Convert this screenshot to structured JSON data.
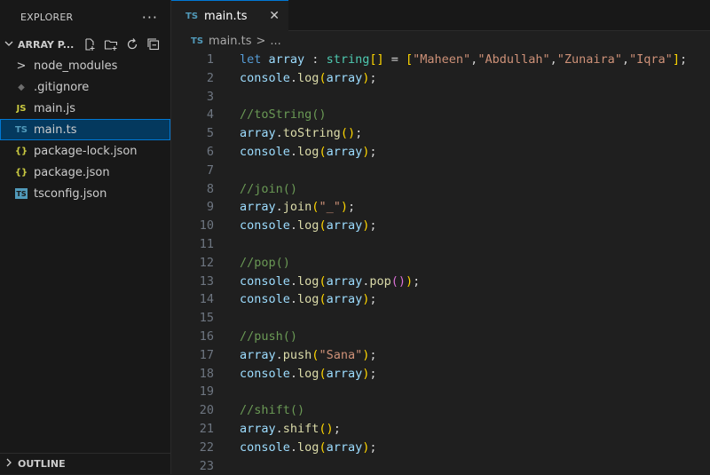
{
  "explorer": {
    "title": "EXPLORER",
    "more": "···",
    "project": "ARRAY P...",
    "items": [
      {
        "label": "node_modules",
        "icon": ">",
        "icon_name": "chevron-right-icon",
        "color": "#cccccc"
      },
      {
        "label": ".gitignore",
        "icon": "◆",
        "icon_name": "git-icon",
        "color": "#6d6d6d"
      },
      {
        "label": "main.js",
        "icon": "JS",
        "icon_name": "js-file-icon",
        "color": "#cbcb41"
      },
      {
        "label": "main.ts",
        "icon": "TS",
        "icon_name": "ts-file-icon",
        "color": "#519aba"
      },
      {
        "label": "package-lock.json",
        "icon": "{}",
        "icon_name": "json-file-icon",
        "color": "#cbcb41"
      },
      {
        "label": "package.json",
        "icon": "{}",
        "icon_name": "json-file-icon",
        "color": "#cbcb41"
      },
      {
        "label": "tsconfig.json",
        "icon": "TS",
        "icon_name": "tsconfig-file-icon",
        "color": "#519aba"
      }
    ],
    "active_index": 3,
    "outline": "OUTLINE"
  },
  "tab": {
    "badge": "TS",
    "label": "main.ts",
    "close": "✕"
  },
  "breadcrumb": {
    "badge": "TS",
    "file": "main.ts",
    "sep": ">",
    "more": "..."
  },
  "code_lines": [
    [
      [
        "kw",
        "let"
      ],
      [
        "pun",
        " "
      ],
      [
        "var",
        "array"
      ],
      [
        "pun",
        " : "
      ],
      [
        "ty",
        "string"
      ],
      [
        "b1",
        "[]"
      ],
      [
        "pun",
        " = "
      ],
      [
        "b1",
        "["
      ],
      [
        "str",
        "\"Maheen\""
      ],
      [
        "pun",
        ","
      ],
      [
        "str",
        "\"Abdullah\""
      ],
      [
        "pun",
        ","
      ],
      [
        "str",
        "\"Zunaira\""
      ],
      [
        "pun",
        ","
      ],
      [
        "str",
        "\"Iqra\""
      ],
      [
        "b1",
        "]"
      ],
      [
        "pun",
        ";"
      ]
    ],
    [
      [
        "var",
        "console"
      ],
      [
        "pun",
        "."
      ],
      [
        "fn",
        "log"
      ],
      [
        "b1",
        "("
      ],
      [
        "var",
        "array"
      ],
      [
        "b1",
        ")"
      ],
      [
        "pun",
        ";"
      ]
    ],
    [],
    [
      [
        "cm",
        "//toString()"
      ]
    ],
    [
      [
        "var",
        "array"
      ],
      [
        "pun",
        "."
      ],
      [
        "fn",
        "toString"
      ],
      [
        "b1",
        "()"
      ],
      [
        "pun",
        ";"
      ]
    ],
    [
      [
        "var",
        "console"
      ],
      [
        "pun",
        "."
      ],
      [
        "fn",
        "log"
      ],
      [
        "b1",
        "("
      ],
      [
        "var",
        "array"
      ],
      [
        "b1",
        ")"
      ],
      [
        "pun",
        ";"
      ]
    ],
    [],
    [
      [
        "cm",
        "//join()"
      ]
    ],
    [
      [
        "var",
        "array"
      ],
      [
        "pun",
        "."
      ],
      [
        "fn",
        "join"
      ],
      [
        "b1",
        "("
      ],
      [
        "str",
        "\"_\""
      ],
      [
        "b1",
        ")"
      ],
      [
        "pun",
        ";"
      ]
    ],
    [
      [
        "var",
        "console"
      ],
      [
        "pun",
        "."
      ],
      [
        "fn",
        "log"
      ],
      [
        "b1",
        "("
      ],
      [
        "var",
        "array"
      ],
      [
        "b1",
        ")"
      ],
      [
        "pun",
        ";"
      ]
    ],
    [],
    [
      [
        "cm",
        "//pop()"
      ]
    ],
    [
      [
        "var",
        "console"
      ],
      [
        "pun",
        "."
      ],
      [
        "fn",
        "log"
      ],
      [
        "b1",
        "("
      ],
      [
        "var",
        "array"
      ],
      [
        "pun",
        "."
      ],
      [
        "fn",
        "pop"
      ],
      [
        "b2",
        "()"
      ],
      [
        "b1",
        ")"
      ],
      [
        "pun",
        ";"
      ]
    ],
    [
      [
        "var",
        "console"
      ],
      [
        "pun",
        "."
      ],
      [
        "fn",
        "log"
      ],
      [
        "b1",
        "("
      ],
      [
        "var",
        "array"
      ],
      [
        "b1",
        ")"
      ],
      [
        "pun",
        ";"
      ]
    ],
    [],
    [
      [
        "cm",
        "//push()"
      ]
    ],
    [
      [
        "var",
        "array"
      ],
      [
        "pun",
        "."
      ],
      [
        "fn",
        "push"
      ],
      [
        "b1",
        "("
      ],
      [
        "str",
        "\"Sana\""
      ],
      [
        "b1",
        ")"
      ],
      [
        "pun",
        ";"
      ]
    ],
    [
      [
        "var",
        "console"
      ],
      [
        "pun",
        "."
      ],
      [
        "fn",
        "log"
      ],
      [
        "b1",
        "("
      ],
      [
        "var",
        "array"
      ],
      [
        "b1",
        ")"
      ],
      [
        "pun",
        ";"
      ]
    ],
    [],
    [
      [
        "cm",
        "//shift()"
      ]
    ],
    [
      [
        "var",
        "array"
      ],
      [
        "pun",
        "."
      ],
      [
        "fn",
        "shift"
      ],
      [
        "b1",
        "()"
      ],
      [
        "pun",
        ";"
      ]
    ],
    [
      [
        "var",
        "console"
      ],
      [
        "pun",
        "."
      ],
      [
        "fn",
        "log"
      ],
      [
        "b1",
        "("
      ],
      [
        "var",
        "array"
      ],
      [
        "b1",
        ")"
      ],
      [
        "pun",
        ";"
      ]
    ],
    []
  ]
}
